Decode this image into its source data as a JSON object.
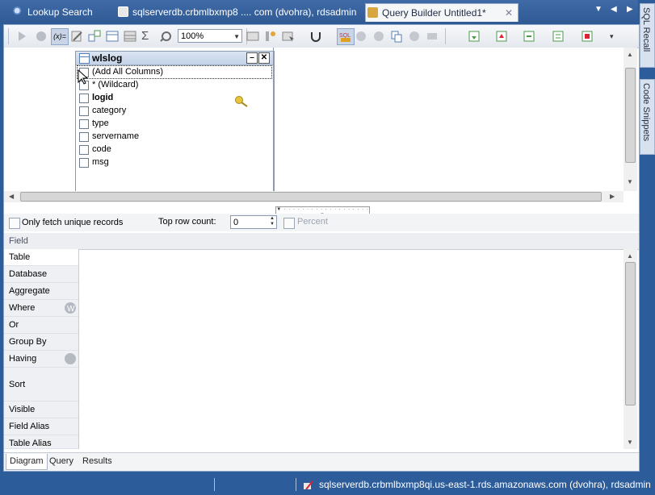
{
  "tabs": [
    {
      "label": "Lookup Search",
      "active": false
    },
    {
      "label": "sqlserverdb.crbmlbxmp8 .... com (dvohra), rdsadmin",
      "active": false
    },
    {
      "label": "Query Builder Untitled1*",
      "active": true
    }
  ],
  "tab_close": "✕",
  "side_tabs": [
    "SQL Recall",
    "Code Snippets"
  ],
  "toolbar": {
    "zoom": "100%"
  },
  "table": {
    "name": "wlslog",
    "add_all": "(Add All Columns)",
    "wildcard": "* (Wildcard)",
    "columns": [
      {
        "name": "logid",
        "key": true
      },
      {
        "name": "category"
      },
      {
        "name": "type"
      },
      {
        "name": "servername"
      },
      {
        "name": "code"
      },
      {
        "name": "msg"
      }
    ]
  },
  "options": {
    "unique_label": "Only fetch unique records",
    "top_row_label": "Top row count:",
    "top_row_value": "0",
    "percent_label": "Percent"
  },
  "grid": {
    "header": "Field",
    "rows": [
      "Table",
      "Database",
      "Aggregate",
      "Where",
      "Or",
      "Group By",
      "Having",
      "Sort",
      "Visible",
      "Field Alias",
      "Table Alias"
    ]
  },
  "bottom_tabs": [
    "Diagram",
    "Query",
    "Results"
  ],
  "status": {
    "connection": "sqlserverdb.crbmlbxmp8qi.us-east-1.rds.amazonaws.com (dvohra), rdsadmin"
  },
  "colors": {
    "chrome": "#2d5c9a",
    "accent": "#3f6aa6"
  }
}
